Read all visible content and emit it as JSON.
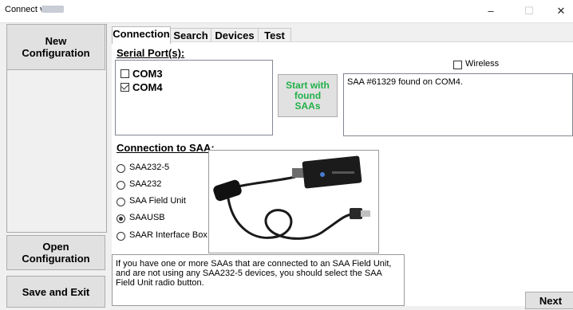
{
  "window": {
    "title": "Connect v.",
    "minimize": "–",
    "maximize": "☐",
    "close": "✕"
  },
  "sidebar": {
    "new_config": [
      "New",
      "Configuration"
    ],
    "open_config": [
      "Open",
      "Configuration"
    ],
    "save_exit": "Save and Exit"
  },
  "tabs": [
    "Connection",
    "Search",
    "Devices",
    "Test"
  ],
  "serial": {
    "title": "Serial Port(s):",
    "ports": [
      {
        "label": "COM3",
        "checked": false
      },
      {
        "label": "COM4",
        "checked": true
      }
    ],
    "start_button": [
      "Start with",
      "found",
      "SAAs"
    ],
    "wireless_label": "Wireless",
    "wireless_checked": false,
    "log": "SAA #61329 found on COM4."
  },
  "connection": {
    "title": "Connection to SAA:",
    "options": [
      {
        "label": "SAA232-5",
        "selected": false
      },
      {
        "label": "SAA232",
        "selected": false
      },
      {
        "label": "SAA Field Unit",
        "selected": false
      },
      {
        "label": "SAAUSB",
        "selected": true
      },
      {
        "label": "SAAR Interface Box",
        "selected": false
      }
    ],
    "info": "If you have one or more SAAs that are connected to an SAA Field Unit, and are not using any SAA232-5 devices, you should select the SAA Field Unit radio button."
  },
  "next_label": "Next"
}
